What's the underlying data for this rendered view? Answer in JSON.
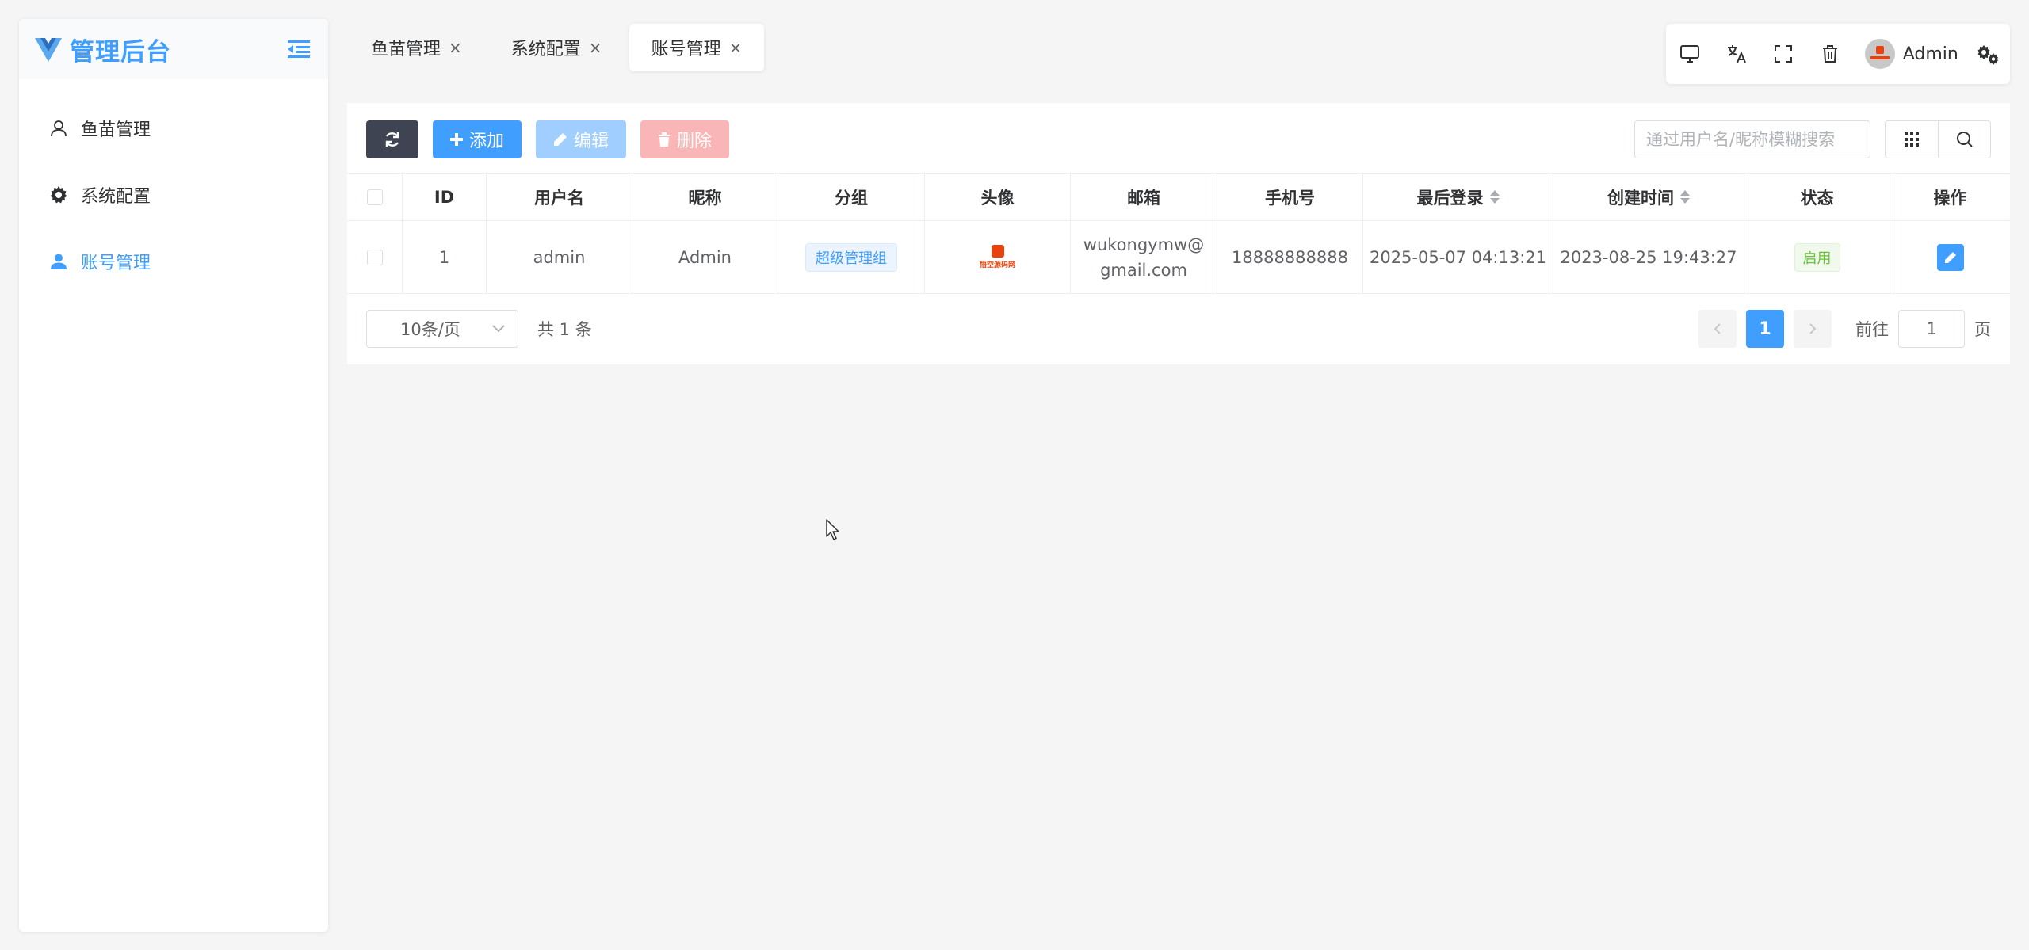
{
  "sidebar": {
    "logo_text": "管理后台",
    "items": [
      {
        "label": "鱼苗管理"
      },
      {
        "label": "系统配置"
      },
      {
        "label": "账号管理"
      }
    ]
  },
  "tabs": [
    {
      "label": "鱼苗管理"
    },
    {
      "label": "系统配置"
    },
    {
      "label": "账号管理"
    }
  ],
  "header": {
    "user_name": "Admin"
  },
  "actions": {
    "add_label": "添加",
    "edit_label": "编辑",
    "delete_label": "删除"
  },
  "search": {
    "placeholder": "通过用户名/昵称模糊搜索"
  },
  "table": {
    "columns": [
      "ID",
      "用户名",
      "昵称",
      "分组",
      "头像",
      "邮箱",
      "手机号",
      "最后登录",
      "创建时间",
      "状态",
      "操作"
    ],
    "rows": [
      {
        "id": "1",
        "username": "admin",
        "nickname": "Admin",
        "group": "超级管理组",
        "avatar_text": "悟空源码网",
        "email_line1": "wukongymw@",
        "email_line2": "gmail.com",
        "phone": "18888888888",
        "last_login": "2025-05-07 04:13:21",
        "created": "2023-08-25 19:43:27",
        "status": "启用"
      }
    ]
  },
  "pagination": {
    "page_size": "10条/页",
    "total": "共 1 条",
    "current_page": "1",
    "goto_label": "前往",
    "goto_value": "1",
    "goto_suffix": "页"
  },
  "colors": {
    "primary": "#409eff",
    "dark_button": "#3e4451",
    "success": "#67c23a",
    "danger_light": "#fab6b6"
  }
}
